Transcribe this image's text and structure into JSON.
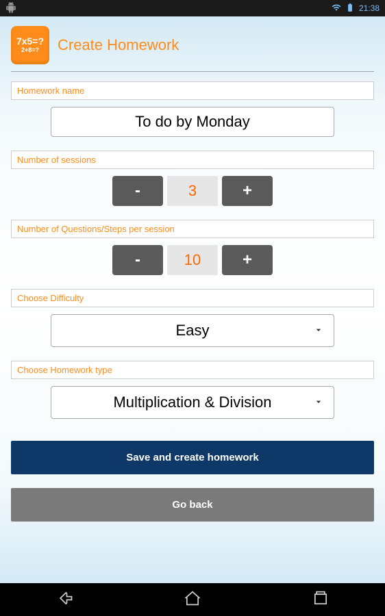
{
  "status": {
    "time": "21:38"
  },
  "header": {
    "title": "Create Homework",
    "icon_line1": "7x5=?",
    "icon_line2": "2+8=?"
  },
  "fields": {
    "name": {
      "label": "Homework name",
      "value": "To do by Monday"
    },
    "sessions": {
      "label": "Number of sessions",
      "value": "3",
      "minus": "-",
      "plus": "+"
    },
    "questions": {
      "label": "Number of Questions/Steps per session",
      "value": "10",
      "minus": "-",
      "plus": "+"
    },
    "difficulty": {
      "label": "Choose Difficulty",
      "value": "Easy"
    },
    "type": {
      "label": "Choose Homework type",
      "value": "Multiplication & Division"
    }
  },
  "buttons": {
    "save": "Save and create homework",
    "back": "Go back"
  }
}
